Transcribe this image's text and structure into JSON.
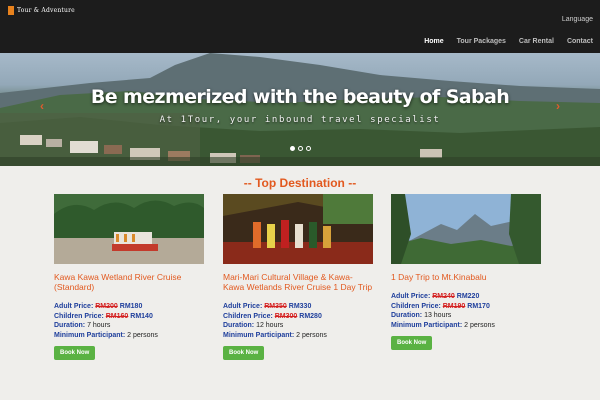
{
  "header": {
    "logo_text": "Tour & Adventure",
    "language_label": "Language",
    "nav": [
      "Home",
      "Tour Packages",
      "Car Rental",
      "Contact"
    ]
  },
  "hero": {
    "title": "Be mezmerized with the beauty of Sabah",
    "subtitle": "At 1Tour, your inbound travel specialist",
    "prev_arrow": "‹",
    "next_arrow": "›",
    "slide_count": 3,
    "active_slide": 1
  },
  "section": {
    "title": "-- Top Destination --"
  },
  "labels": {
    "adult": "Adult Price:",
    "children": "Children Price:",
    "duration": "Duration:",
    "min_participant": "Minimum Participant:",
    "book": "Book Now"
  },
  "cards": [
    {
      "title": "Kawa Kawa Wetland River Cruise (Standard)",
      "adult_old": "RM200",
      "adult_new": "RM180",
      "child_old": "RM160",
      "child_new": "RM140",
      "duration": "7 hours",
      "min_participant": "2 persons"
    },
    {
      "title": "Mari-Mari Cultural Village & Kawa-Kawa Wetlands River Cruise 1 Day Trip",
      "adult_old": "RM350",
      "adult_new": "RM330",
      "child_old": "RM300",
      "child_new": "RM280",
      "duration": "12 hours",
      "min_participant": "2 persons"
    },
    {
      "title": "1 Day Trip to Mt.Kinabalu",
      "adult_old": "RM240",
      "adult_new": "RM220",
      "child_old": "RM190",
      "child_new": "RM170",
      "duration": "13 hours",
      "min_participant": "2 persons"
    }
  ],
  "colors": {
    "header_bg": "#1c1c1c",
    "accent_orange": "#e2591f",
    "label_blue": "#1f3f9c",
    "old_price_red": "#d42020",
    "button_green": "#5ab243",
    "page_bg": "#efeeeb"
  }
}
